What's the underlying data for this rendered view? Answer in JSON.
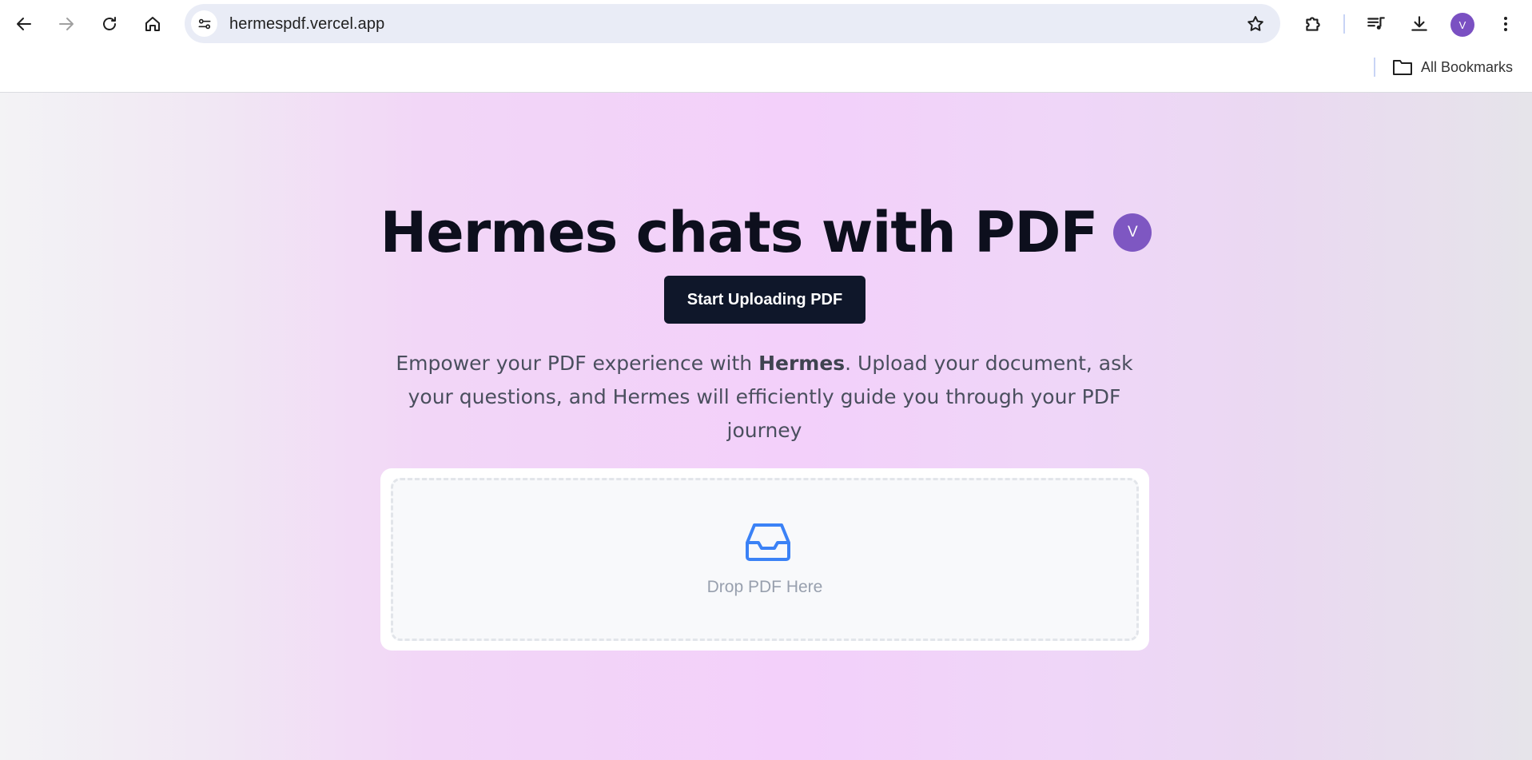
{
  "browser": {
    "url": "hermespdf.vercel.app",
    "profile_initial": "V",
    "bookmarks_label": "All Bookmarks"
  },
  "page": {
    "title": "Hermes chats with PDF",
    "avatar_initial": "V",
    "cta_label": "Start Uploading PDF",
    "description_before": "Empower your PDF experience with ",
    "description_bold": "Hermes",
    "description_after": ". Upload your document, ask your questions, and Hermes will efficiently guide you through your PDF journey",
    "dropzone_label": "Drop PDF Here"
  },
  "colors": {
    "accent_purple": "#7e57c2",
    "button_dark": "#0f172a",
    "inbox_icon_blue": "#3b82f6"
  }
}
